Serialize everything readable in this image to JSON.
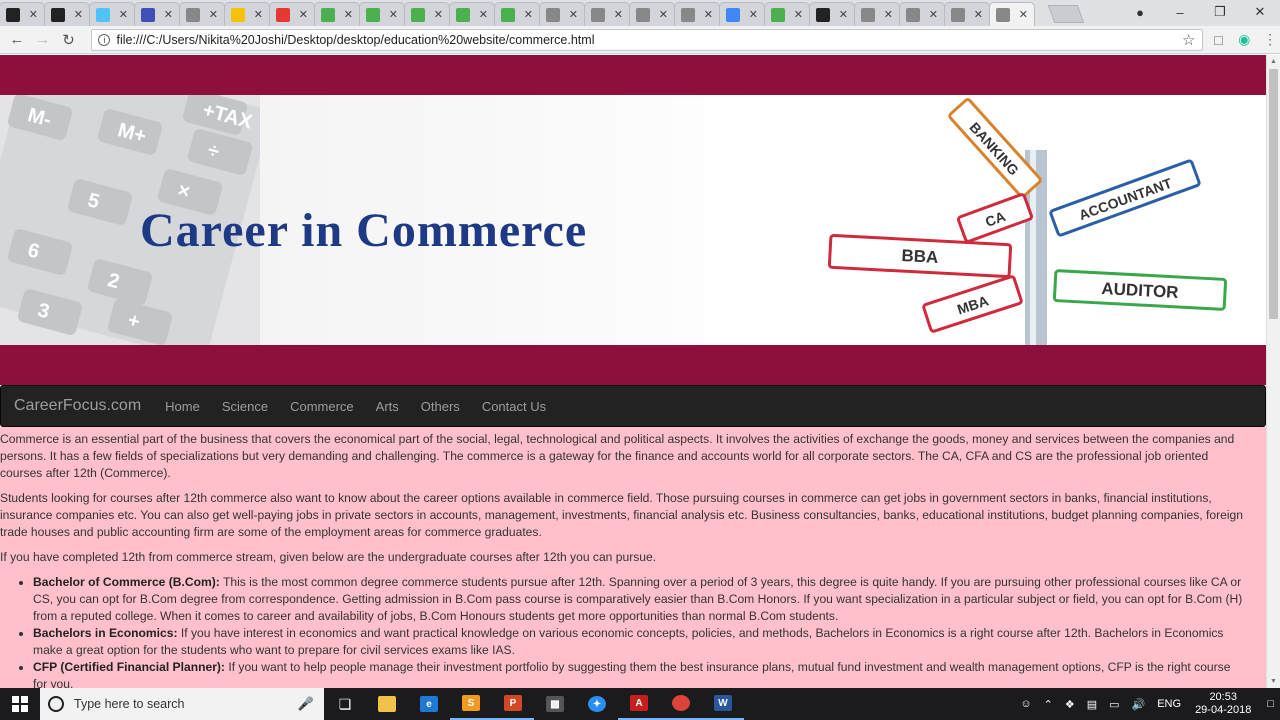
{
  "browser": {
    "address": "file:///C:/Users/Nikita%20Joshi/Desktop/desktop/education%20website/commerce.html",
    "tabs": [
      {
        "icon": "graduation-cap-icon",
        "color": "#222"
      },
      {
        "icon": "graduation-cap-icon",
        "color": "#222",
        "active": true
      },
      {
        "icon": "globe-icon",
        "color": "#4fc3f7"
      },
      {
        "icon": "book-icon",
        "color": "#3f51b5"
      },
      {
        "icon": "document-icon",
        "color": "#888"
      },
      {
        "icon": "bolt-icon",
        "color": "#f4c20d"
      },
      {
        "icon": "opera-icon",
        "color": "#e53935"
      },
      {
        "icon": "w3-icon",
        "color": "#4caf50"
      },
      {
        "icon": "w3-icon",
        "color": "#4caf50"
      },
      {
        "icon": "w3-icon",
        "color": "#4caf50"
      },
      {
        "icon": "w3-icon",
        "color": "#4caf50"
      },
      {
        "icon": "w3-icon",
        "color": "#4caf50"
      },
      {
        "icon": "document-icon",
        "color": "#888"
      },
      {
        "icon": "document-icon",
        "color": "#888"
      },
      {
        "icon": "document-icon",
        "color": "#888"
      },
      {
        "icon": "document-icon",
        "color": "#888"
      },
      {
        "icon": "google-icon",
        "color": "#4285f4"
      },
      {
        "icon": "w3-icon",
        "color": "#4caf50"
      },
      {
        "icon": "github-icon",
        "color": "#222"
      },
      {
        "icon": "document-icon",
        "color": "#888"
      },
      {
        "icon": "document-icon",
        "color": "#888"
      },
      {
        "icon": "document-icon",
        "color": "#888"
      },
      {
        "icon": "document-icon",
        "color": "#888",
        "active": true
      }
    ]
  },
  "banner": {
    "title": "Career in Commerce",
    "signs": [
      "BANKING",
      "ACCOUNTANT",
      "CA",
      "BBA",
      "AUDITOR",
      "MBA"
    ],
    "keys": [
      "M-",
      "M+",
      "+TAX",
      "÷",
      "×",
      "5",
      "6",
      "2",
      "3",
      "+"
    ]
  },
  "navbar": {
    "brand": "CareerFocus.com",
    "links": [
      "Home",
      "Science",
      "Commerce",
      "Arts",
      "Others",
      "Contact Us"
    ]
  },
  "content": {
    "p1": "Commerce is an essential part of the business that covers the economical part of the social, legal, technological and political aspects. It involves the activities of exchange the goods, money and services between the companies and persons. It has a few fields of specializations but very demanding and challenging. The commerce is a gateway for the finance and accounts world for all corporate sectors. The CA, CFA and CS are the professional job oriented courses after 12th (Commerce).",
    "p2": "Students looking for courses after 12th commerce also want to know about the career options available in commerce field. Those pursuing courses in commerce can get jobs in government sectors in banks, financial institutions, insurance companies etc. You can also get well-paying jobs in private sectors in accounts, management, investments, financial analysis etc. Business consultancies, banks, educational institutions, budget planning companies, foreign trade houses and public accounting firm are some of the employment areas for commerce graduates.",
    "p3": "If you have completed 12th from commerce stream, given below are the undergraduate courses after 12th you can pursue.",
    "courses": [
      {
        "name": "Bachelor of Commerce (B.Com):",
        "text": " This is the most common degree commerce students pursue after 12th. Spanning over a period of 3 years, this degree is quite handy. If you are pursuing other professional courses like CA or CS, you can opt for B.Com degree from correspondence. Getting admission in B.Com pass course is comparatively easier than B.Com Honors. If you want specialization in a particular subject or field, you can opt for B.Com (H) from a reputed college. When it comes to career and availability of jobs, B.Com Honours students get more opportunities than normal B.Com students."
      },
      {
        "name": "Bachelors in Economics:",
        "text": " If you have interest in economics and want practical knowledge on various economic concepts, policies, and methods, Bachelors in Economics is a right course after 12th. Bachelors in Economics make a great option for the students who want to prepare for civil services exams like IAS."
      },
      {
        "name": "CFP (Certified Financial Planner):",
        "text": " If you want to help people manage their investment portfolio by suggesting them the best insurance plans, mutual fund investment and wealth management options, CFP is the right course for you."
      }
    ]
  },
  "taskbar": {
    "search_placeholder": "Type here to search",
    "lang": "ENG",
    "time": "20:53",
    "date": "29-04-2018"
  },
  "colors": {
    "maroon": "#8c0f3d",
    "content_bg": "#ffc0cb",
    "navbar": "#222222",
    "title": "#1e3a85"
  }
}
